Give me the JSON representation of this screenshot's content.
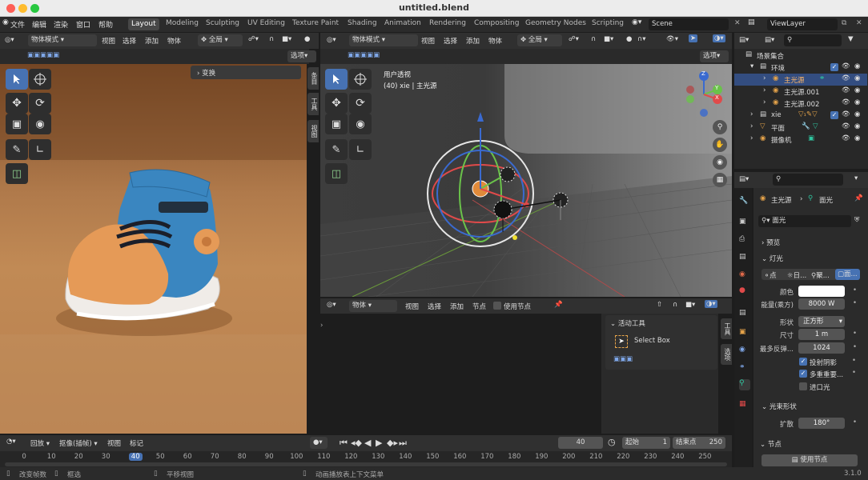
{
  "window": {
    "title": "untitled.blend"
  },
  "menu": [
    "文件",
    "编辑",
    "渲染",
    "窗口",
    "帮助"
  ],
  "workspaces": [
    "Layout",
    "Modeling",
    "Sculpting",
    "UV Editing",
    "Texture Paint",
    "Shading",
    "Animation",
    "Rendering",
    "Compositing",
    "Geometry Nodes",
    "Scripting"
  ],
  "scene": {
    "name": "Scene",
    "view_layer": "ViewLayer"
  },
  "left_view": {
    "mode": "物体模式",
    "menus": [
      "视图",
      "选择",
      "添加",
      "物体"
    ],
    "transform": "全局",
    "options": "选项",
    "panel_title": "变换",
    "tabs": [
      "条目",
      "工具",
      "视图"
    ]
  },
  "center_view": {
    "mode": "物体模式",
    "menus": [
      "视图",
      "选择",
      "添加",
      "物体"
    ],
    "transform": "全局",
    "options": "选项",
    "overlay_title": "用户透视",
    "overlay_sub": "(40) xie | 主光源",
    "gizmo_axes": [
      "X",
      "Y",
      "Z"
    ]
  },
  "node_editor": {
    "type": "物体",
    "menus": [
      "视图",
      "选择",
      "添加",
      "节点"
    ],
    "use_nodes": "使用节点",
    "tabs": [
      "工具",
      "选项"
    ],
    "active_tool_header": "活动工具",
    "active_tool": "Select Box"
  },
  "outliner": {
    "items": [
      {
        "label": "场景集合",
        "depth": 0
      },
      {
        "label": "环境",
        "depth": 1
      },
      {
        "label": "主光源",
        "depth": 2,
        "selected": true
      },
      {
        "label": "主光源.001",
        "depth": 2
      },
      {
        "label": "主光源.002",
        "depth": 2
      },
      {
        "label": "xie",
        "depth": 1
      },
      {
        "label": "平面",
        "depth": 1
      },
      {
        "label": "摄像机",
        "depth": 1
      }
    ]
  },
  "properties": {
    "object": "主光源",
    "data": "面光",
    "datablock": "面光",
    "sections": {
      "preview": "预览",
      "light": "灯光",
      "beam_shape": "光束形状",
      "nodes": "节点"
    },
    "light_types": [
      "点",
      "日...",
      "聚...",
      "面..."
    ],
    "fields": [
      {
        "label": "颜色",
        "value": ""
      },
      {
        "label": "能量(乘方)",
        "value": "8000 W"
      },
      {
        "label": "形状",
        "value": "正方形"
      },
      {
        "label": "尺寸",
        "value": "1 m"
      },
      {
        "label": "最多反弹...",
        "value": "1024"
      }
    ],
    "checks": [
      {
        "label": "投射阴影",
        "checked": true
      },
      {
        "label": "多重重要...",
        "checked": true
      },
      {
        "label": "进口光",
        "checked": false
      }
    ],
    "spread": {
      "label": "扩散",
      "value": "180°"
    },
    "use_nodes_button": "使用节点"
  },
  "timeline": {
    "menus": [
      "回放",
      "抠像(插帧)",
      "视图",
      "标记"
    ],
    "current_frame": "40",
    "start_label": "起始",
    "start": "1",
    "end_label": "结束点",
    "end": "250",
    "ticks": [
      "0",
      "10",
      "20",
      "30",
      "40",
      "50",
      "60",
      "70",
      "80",
      "90",
      "100",
      "110",
      "120",
      "130",
      "140",
      "150",
      "160",
      "170",
      "180",
      "190",
      "200",
      "210",
      "220",
      "230",
      "240",
      "250"
    ]
  },
  "statusbar": {
    "items": [
      "改变帧数",
      "框选",
      "平移视图",
      "动画播放表上下文菜单"
    ],
    "version": "3.1.0"
  },
  "colors": {
    "accent": "#4772b3",
    "render_bg": "#b8804f",
    "viewport_bg": "#3b3b3b"
  }
}
